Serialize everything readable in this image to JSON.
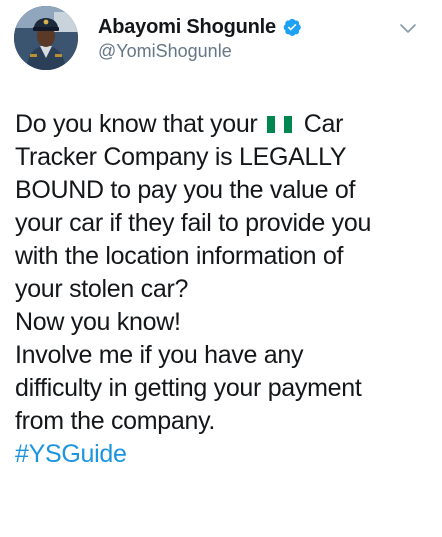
{
  "author": {
    "display_name": "Abayomi Shogunle",
    "handle": "@YomiShogunle",
    "verified": true
  },
  "icons": {
    "verified": "verified-badge-icon",
    "menu": "chevron-down-icon",
    "flag": "nigeria-flag-emoji"
  },
  "tweet": {
    "line1_before_flag": "Do you know that your",
    "line1_after_flag": "Car",
    "line2": "Tracker Company is LEGALLY",
    "line3": "BOUND to pay you the value of",
    "line4": "your car if they fail to provide you",
    "line5": "with the location information of",
    "line6": "your stolen car?",
    "line7": "Now you know!",
    "line8": "Involve me if you have any",
    "line9": "difficulty in getting your payment",
    "line10": "from the company.",
    "hashtag": "#YSGuide"
  },
  "colors": {
    "text": "#14171a",
    "secondary_text": "#657786",
    "link": "#1b95e0",
    "verified_badge": "#1da1f2",
    "flag_green": "#008751",
    "flag_white": "#ffffff"
  }
}
